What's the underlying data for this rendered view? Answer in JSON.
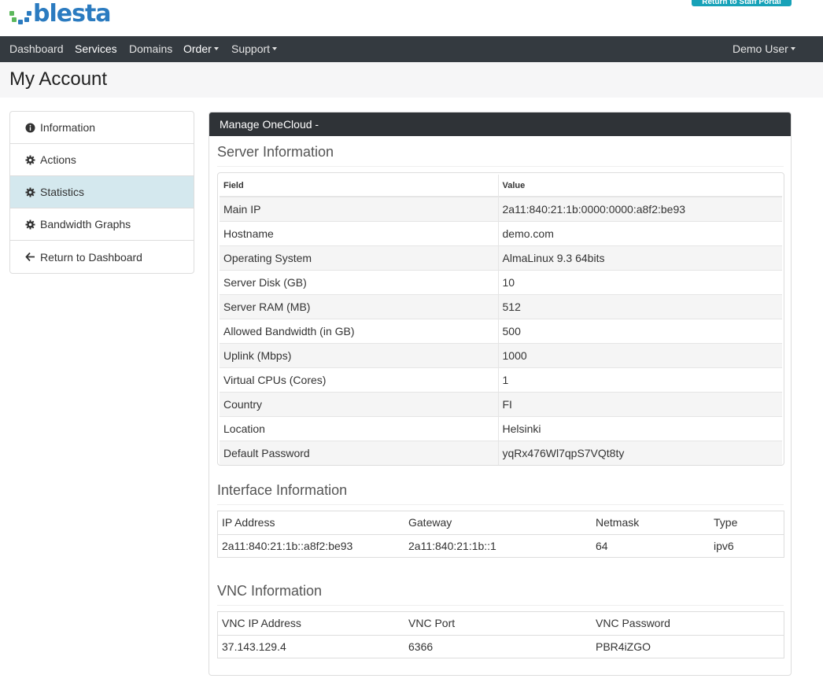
{
  "header": {
    "logo_text": "blesta",
    "staff_button_label": "Return to Staff Portal"
  },
  "nav": {
    "items": [
      {
        "label": "Dashboard"
      },
      {
        "label": "Services"
      },
      {
        "label": "Domains"
      },
      {
        "label": "Order"
      },
      {
        "label": "Support"
      }
    ],
    "user_menu": "Demo User"
  },
  "page": {
    "title": "My Account"
  },
  "sidebar": {
    "items": [
      {
        "label": "Information",
        "icon": "info-circle-icon"
      },
      {
        "label": "Actions",
        "icon": "gear-icon"
      },
      {
        "label": "Statistics",
        "icon": "gear-icon"
      },
      {
        "label": "Bandwidth Graphs",
        "icon": "gear-icon"
      },
      {
        "label": "Return to Dashboard",
        "icon": "arrow-left-icon"
      }
    ]
  },
  "panel": {
    "title": "Manage OneCloud -",
    "server": {
      "heading": "Server Information",
      "columns": [
        "Field",
        "Value"
      ],
      "rows": [
        [
          "Main IP",
          "2a11:840:21:1b:0000:0000:a8f2:be93"
        ],
        [
          "Hostname",
          "demo.com"
        ],
        [
          "Operating System",
          "AlmaLinux 9.3 64bits"
        ],
        [
          "Server Disk (GB)",
          "10"
        ],
        [
          "Server RAM (MB)",
          "512"
        ],
        [
          "Allowed Bandwidth (in GB)",
          "500"
        ],
        [
          "Uplink (Mbps)",
          "1000"
        ],
        [
          "Virtual CPUs (Cores)",
          "1"
        ],
        [
          "Country",
          "FI"
        ],
        [
          "Location",
          "Helsinki"
        ],
        [
          "Default Password",
          "yqRx476Wl7qpS7VQt8ty"
        ]
      ]
    },
    "interface": {
      "heading": "Interface Information",
      "columns": [
        "IP Address",
        "Gateway",
        "Netmask",
        "Type"
      ],
      "rows": [
        [
          "2a11:840:21:1b::a8f2:be93",
          "2a11:840:21:1b::1",
          "64",
          "ipv6"
        ]
      ]
    },
    "vnc": {
      "heading": "VNC Information",
      "columns": [
        "VNC IP Address",
        "VNC Port",
        "VNC Password"
      ],
      "rows": [
        [
          "37.143.129.4",
          "6366",
          "PBR4iZGO"
        ]
      ]
    }
  },
  "colors": {
    "nav_bg": "#343a40",
    "panel_head_bg": "#2f3337",
    "active_sidebar_bg": "#d4e8ee",
    "brand_blue": "#2b7bc0",
    "brand_green": "#5cb85c",
    "staff_button": "#17a2b8"
  }
}
